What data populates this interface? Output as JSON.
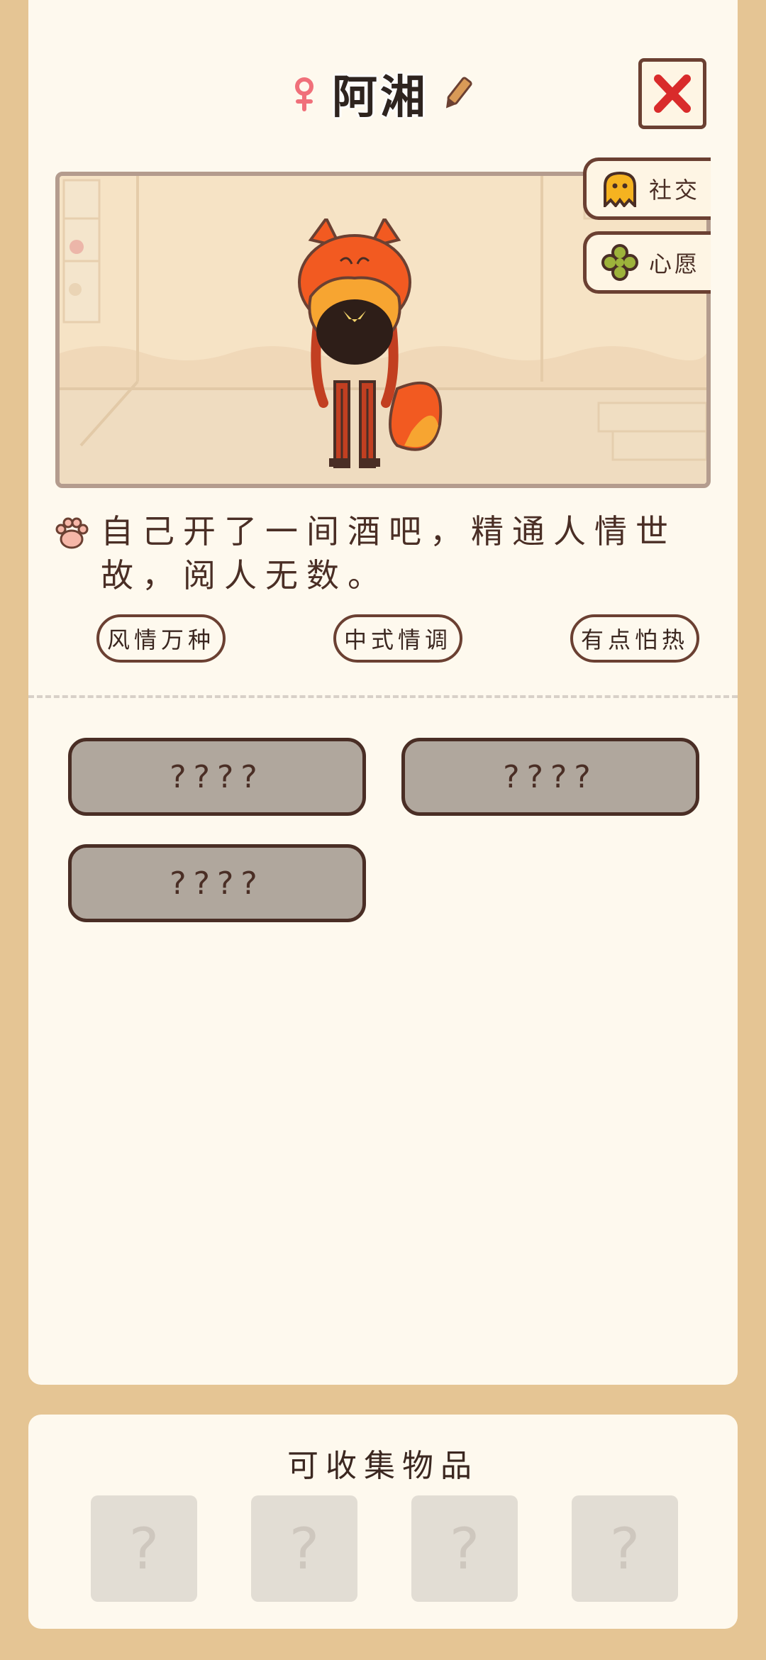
{
  "character": {
    "name": "阿湘",
    "gender_icon": "female-icon",
    "edit_icon": "pencil-icon",
    "description": "自己开了一间酒吧，精通人情世故，阅人无数。",
    "tags": [
      "风情万种",
      "中式情调",
      "有点怕热"
    ]
  },
  "side_buttons": [
    {
      "label": "社交",
      "icon": "ghost-icon"
    },
    {
      "label": "心愿",
      "icon": "clover-icon"
    }
  ],
  "close_icon": "close-icon",
  "locked_stories": [
    "????",
    "????",
    "????"
  ],
  "collectibles": {
    "title": "可收集物品",
    "slots": [
      "?",
      "?",
      "?",
      "?"
    ]
  },
  "colors": {
    "background": "#E5C594",
    "card": "#FEF9EE",
    "outline": "#4A2E25",
    "locked": "#B0A79D",
    "close_x": "#D92B2B"
  }
}
